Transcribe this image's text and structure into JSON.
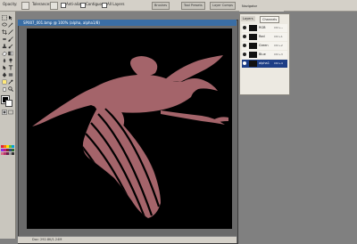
{
  "options_bar": {
    "opacity_label": "Opacity:",
    "tolerance_label": "Tolerance:",
    "anti_alias_label": "Anti-alias",
    "contiguous_label": "Contiguous",
    "all_layers_label": "All Layers",
    "tabs": [
      "Brushes",
      "Tool Presets",
      "Layer Comps"
    ]
  },
  "document": {
    "title": "SP007_001.bmp @ 100% (alpha, alpha1/8)",
    "status": "Doc: 292.8K/1.24M"
  },
  "panels": {
    "navigator_tab": "Navigator",
    "layers_tab": "Layers",
    "channels_tab": "Channels",
    "channels": [
      {
        "name": "RGB",
        "shortcut": "Ctrl+~",
        "selected": false
      },
      {
        "name": "Red",
        "shortcut": "Ctrl+1",
        "selected": false
      },
      {
        "name": "Green",
        "shortcut": "Ctrl+2",
        "selected": false
      },
      {
        "name": "Blue",
        "shortcut": "Ctrl+3",
        "selected": false
      },
      {
        "name": "alpha1",
        "shortcut": "Ctrl+4",
        "selected": true
      }
    ]
  },
  "colors": {
    "canvas": "#000000",
    "shape_fill": "#a4646a",
    "selection_highlight": "#1d3e86"
  }
}
